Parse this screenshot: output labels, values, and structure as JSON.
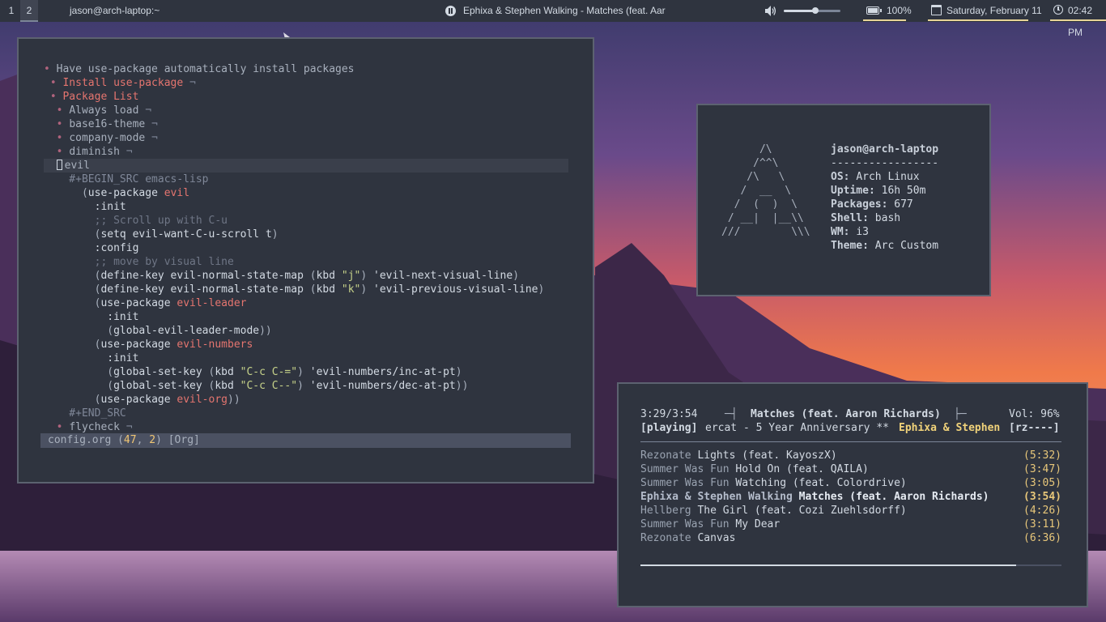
{
  "topbar": {
    "workspaces": [
      "1",
      "2"
    ],
    "active_workspace": "2",
    "window_title": "jason@arch-laptop:~",
    "now_playing": "Ephixa & Stephen Walking - Matches (feat. Aaron Ri...",
    "volume_level": 0.55,
    "battery": "100%",
    "date": "Saturday, February 11",
    "time": "02:42 PM",
    "accent": "#e8d598"
  },
  "emacs": {
    "lines": [
      [
        [
          "c-bul",
          "• "
        ],
        [
          "c-gray",
          "Have use-package automatically install packages"
        ]
      ],
      [
        [
          "c-bul",
          " • "
        ],
        [
          "c-red",
          "Install use-package"
        ],
        [
          "c-blk",
          " ¬"
        ]
      ],
      [
        [
          "c-bul",
          " • "
        ],
        [
          "c-red",
          "Package List"
        ]
      ],
      [
        [
          "c-bul",
          "  • "
        ],
        [
          "c-gray",
          "Always load"
        ],
        [
          "c-blk",
          " ¬"
        ]
      ],
      [
        [
          "c-bul",
          "  • "
        ],
        [
          "c-gray",
          "base16-theme"
        ],
        [
          "c-blk",
          " ¬"
        ]
      ],
      [
        [
          "c-bul",
          "  • "
        ],
        [
          "c-gray",
          "company-mode"
        ],
        [
          "c-blk",
          " ¬"
        ]
      ],
      [
        [
          "c-bul",
          "  • "
        ],
        [
          "c-gray",
          "diminish"
        ],
        [
          "c-blk",
          " ¬"
        ]
      ],
      [
        [
          "cursor",
          "  "
        ],
        [
          "c-gray",
          "evil"
        ]
      ],
      [
        [
          "c-blk",
          "    #+BEGIN_SRC emacs-lisp"
        ]
      ],
      [
        [
          "c-par",
          "      ("
        ],
        [
          "c-key",
          "use-package "
        ],
        [
          "c-red",
          "evil"
        ]
      ],
      [
        [
          "c-key",
          "        :init"
        ]
      ],
      [
        [
          "c-cmt",
          "        ;; Scroll up with C-u"
        ]
      ],
      [
        [
          "c-par",
          "        ("
        ],
        [
          "c-key",
          "setq evil-want-C-u-scroll t"
        ],
        [
          "c-par",
          ")"
        ]
      ],
      [
        [
          "c-key",
          "        :config"
        ]
      ],
      [
        [
          "c-cmt",
          "        ;; move by visual line"
        ]
      ],
      [
        [
          "c-par",
          "        ("
        ],
        [
          "c-key",
          "define-key evil-normal-state-map "
        ],
        [
          "c-par",
          "("
        ],
        [
          "c-key",
          "kbd "
        ],
        [
          "c-str",
          "\"j\""
        ],
        [
          "c-par",
          ")"
        ],
        [
          "c-key",
          " 'evil-next-visual-line"
        ],
        [
          "c-par",
          ")"
        ]
      ],
      [
        [
          "c-par",
          "        ("
        ],
        [
          "c-key",
          "define-key evil-normal-state-map "
        ],
        [
          "c-par",
          "("
        ],
        [
          "c-key",
          "kbd "
        ],
        [
          "c-str",
          "\"k\""
        ],
        [
          "c-par",
          ")"
        ],
        [
          "c-key",
          " 'evil-previous-visual-line"
        ],
        [
          "c-par",
          ")"
        ]
      ],
      [
        [
          "c-par",
          "        ("
        ],
        [
          "c-key",
          "use-package "
        ],
        [
          "c-red",
          "evil-leader"
        ]
      ],
      [
        [
          "c-key",
          "          :init"
        ]
      ],
      [
        [
          "c-par",
          "          ("
        ],
        [
          "c-key",
          "global-evil-leader-mode"
        ],
        [
          "c-par",
          "))"
        ]
      ],
      [
        [
          "c-par",
          "        ("
        ],
        [
          "c-key",
          "use-package "
        ],
        [
          "c-red",
          "evil-numbers"
        ]
      ],
      [
        [
          "c-key",
          "          :init"
        ]
      ],
      [
        [
          "c-par",
          "          ("
        ],
        [
          "c-key",
          "global-set-key "
        ],
        [
          "c-par",
          "("
        ],
        [
          "c-key",
          "kbd "
        ],
        [
          "c-str",
          "\"C-c C-=\""
        ],
        [
          "c-par",
          ")"
        ],
        [
          "c-key",
          " 'evil-numbers/inc-at-pt"
        ],
        [
          "c-par",
          ")"
        ]
      ],
      [
        [
          "c-par",
          "          ("
        ],
        [
          "c-key",
          "global-set-key "
        ],
        [
          "c-par",
          "("
        ],
        [
          "c-key",
          "kbd "
        ],
        [
          "c-str",
          "\"C-c C--\""
        ],
        [
          "c-par",
          ")"
        ],
        [
          "c-key",
          " 'evil-numbers/dec-at-pt"
        ],
        [
          "c-par",
          "))"
        ]
      ],
      [
        [
          "c-par",
          "        ("
        ],
        [
          "c-key",
          "use-package "
        ],
        [
          "c-red",
          "evil-org"
        ],
        [
          "c-par",
          "))"
        ]
      ],
      [
        [
          "c-blk",
          "    #+END_SRC"
        ]
      ],
      [
        [
          "c-bul",
          "  • "
        ],
        [
          "c-gray",
          "flycheck"
        ],
        [
          "c-blk",
          " ¬"
        ]
      ]
    ],
    "modeline": [
      [
        "c-gray",
        "config.org "
      ],
      [
        "c-par",
        "("
      ],
      [
        "c-yel",
        "47"
      ],
      [
        "c-par",
        ", "
      ],
      [
        "c-yel",
        "2"
      ],
      [
        "c-par",
        ") "
      ],
      [
        "c-gray",
        "[Org]"
      ]
    ]
  },
  "neofetch": {
    "logo": [
      "      /\\",
      "     /^^\\",
      "    /\\   \\",
      "   /  __  \\",
      "  /  (  )  \\",
      " / __|  |__\\\\",
      "///        \\\\\\"
    ],
    "user": "jason@arch-laptop",
    "divider": "-----------------",
    "info": [
      {
        "key": "OS",
        "value": "Arch Linux"
      },
      {
        "key": "Uptime",
        "value": "16h 50m"
      },
      {
        "key": "Packages",
        "value": "677"
      },
      {
        "key": "Shell",
        "value": "bash"
      },
      {
        "key": "WM",
        "value": "i3"
      },
      {
        "key": "Theme",
        "value": "Arc Custom"
      }
    ]
  },
  "ncmpcpp": {
    "elapsed": "3:29/3:54",
    "title": "Matches (feat. Aaron Richards)",
    "volume": "Vol: 96%",
    "state": "[playing]",
    "scroller": "ercat - 5 Year Anniversary ** ",
    "scroller_artist": "Ephixa & Stephen",
    "flags": "[rz----]",
    "progress": 0.893,
    "playlist": [
      {
        "artist": "Rezonate",
        "title": "Lights (feat. KayoszX)",
        "duration": "(5:32)",
        "current": false
      },
      {
        "artist": "Summer Was Fun",
        "title": "Hold On (feat. QAILA)",
        "duration": "(3:47)",
        "current": false
      },
      {
        "artist": "Summer Was Fun",
        "title": "Watching (feat. Colordrive)",
        "duration": "(3:05)",
        "current": false
      },
      {
        "artist": "Ephixa & Stephen Walking",
        "title": "Matches (feat. Aaron Richards)",
        "duration": "(3:54)",
        "current": true
      },
      {
        "artist": "Hellberg",
        "title": "The Girl (feat. Cozi Zuehlsdorff)",
        "duration": "(4:26)",
        "current": false
      },
      {
        "artist": "Summer Was Fun",
        "title": "My Dear",
        "duration": "(3:11)",
        "current": false
      },
      {
        "artist": "Rezonate",
        "title": "Canvas",
        "duration": "(6:36)",
        "current": false
      }
    ]
  }
}
